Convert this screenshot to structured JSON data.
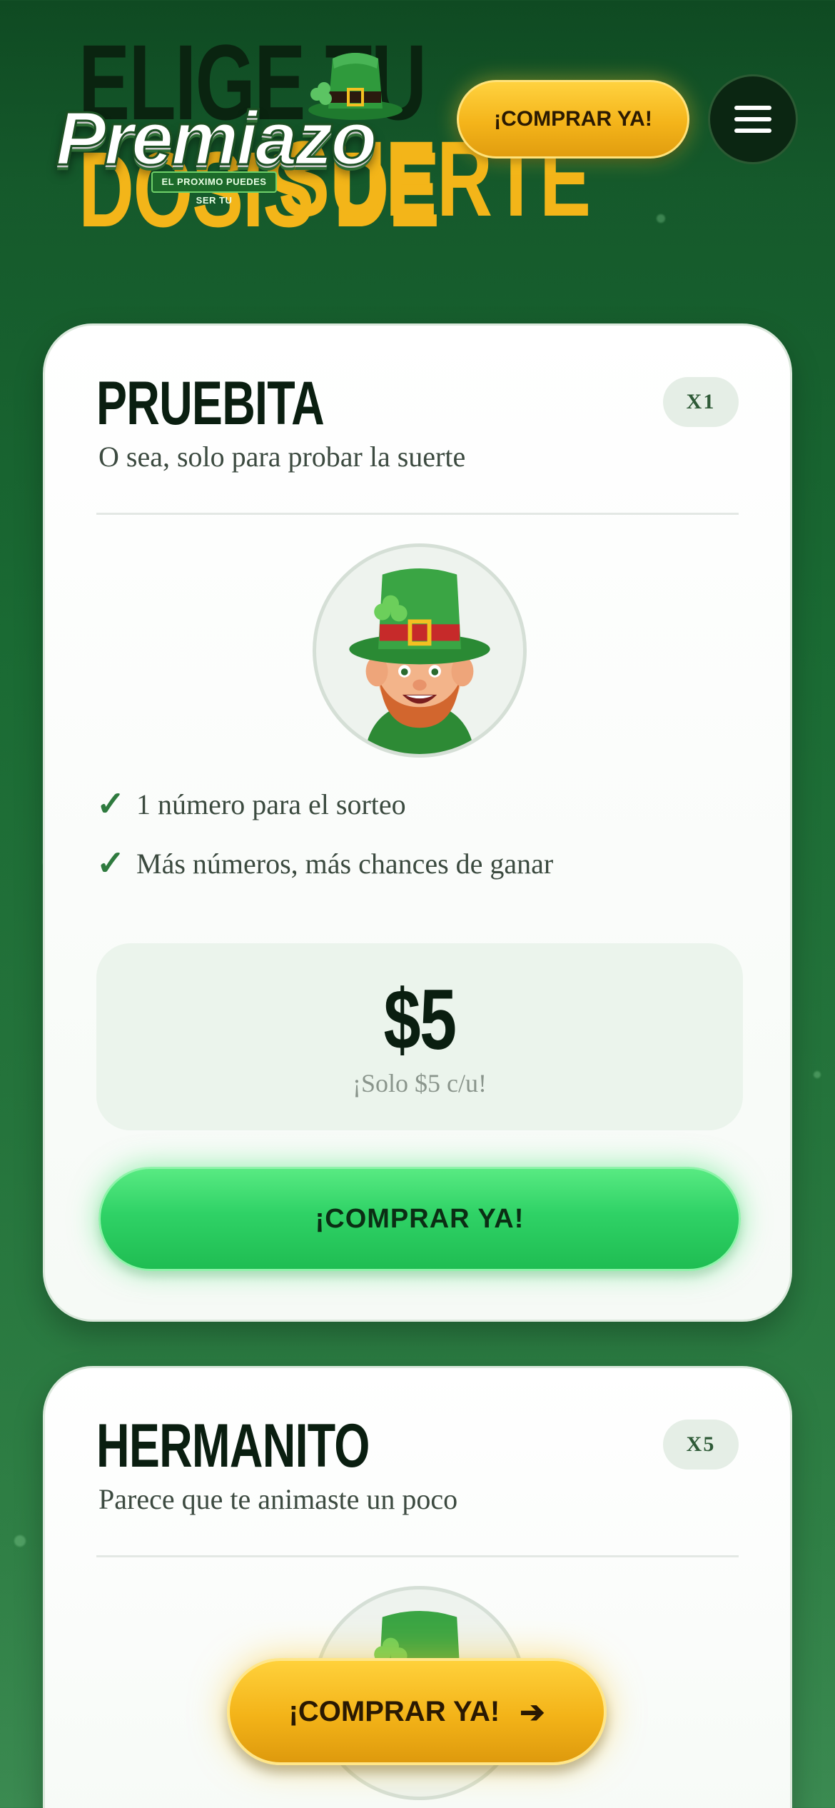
{
  "hero": {
    "line1_dark": "ELIGE TU",
    "line1_gold": "DOSIS DE",
    "line2": "SUERTE"
  },
  "logo": {
    "name": "Premiazo",
    "tagline": "EL PROXIMO PUEDES SER TU"
  },
  "header": {
    "buy_label": "¡COMPRAR YA!",
    "menu_icon": "hamburger-menu-icon"
  },
  "cards": [
    {
      "name": "PRUEBITA",
      "subtitle": "O sea, solo para probar la suerte",
      "badge": "X1",
      "features": [
        "1 número para el sorteo",
        "Más números, más chances de ganar"
      ],
      "price": "$5",
      "price_note": "¡Solo $5 c/u!",
      "buy_label": "¡COMPRAR YA!"
    },
    {
      "name": "HERMANITO",
      "subtitle": "Parece que te animaste un poco",
      "badge": "X5"
    }
  ],
  "floating": {
    "buy_label": "¡COMPRAR YA!",
    "arrow_icon": "arrow-right-icon"
  },
  "colors": {
    "background": "#1a6a33",
    "gold": "#f3b519",
    "green_button": "#2fd266",
    "card": "#ffffff"
  }
}
